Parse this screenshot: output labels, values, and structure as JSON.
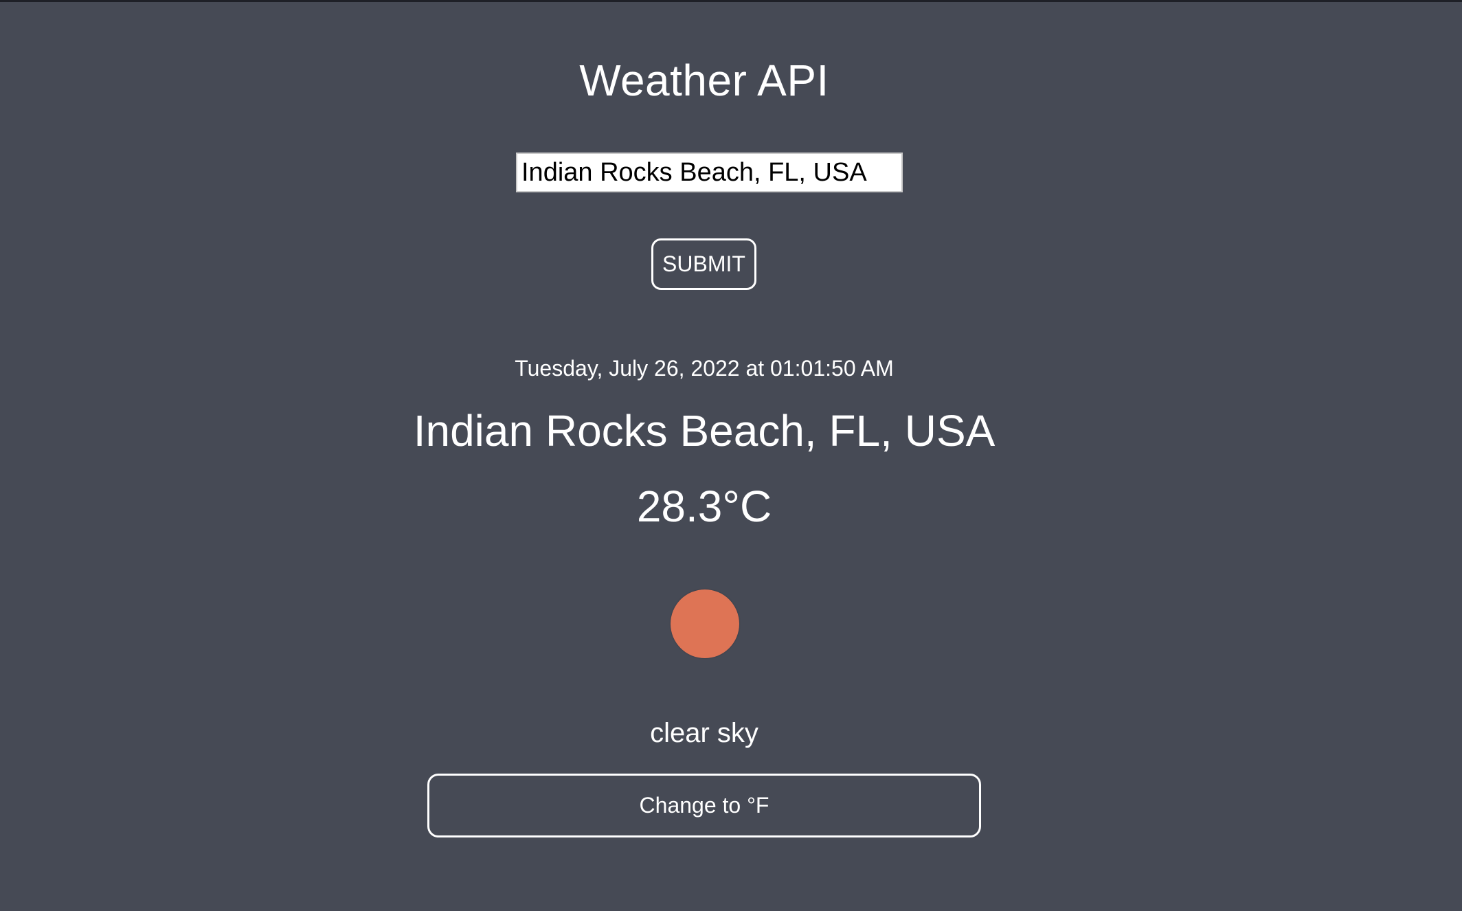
{
  "app": {
    "title": "Weather API"
  },
  "search": {
    "value": "Indian Rocks Beach, FL, USA",
    "submit_label": "SUBMIT"
  },
  "weather": {
    "datetime": "Tuesday, July 26, 2022 at 01:01:50 AM",
    "location": "Indian Rocks Beach, FL, USA",
    "temperature": "28.3°C",
    "icon": "sun-icon",
    "icon_color": "#de7455",
    "description": "clear sky"
  },
  "unit_toggle": {
    "label": "Change to °F"
  },
  "colors": {
    "background": "#464a55",
    "text": "#ffffff"
  }
}
